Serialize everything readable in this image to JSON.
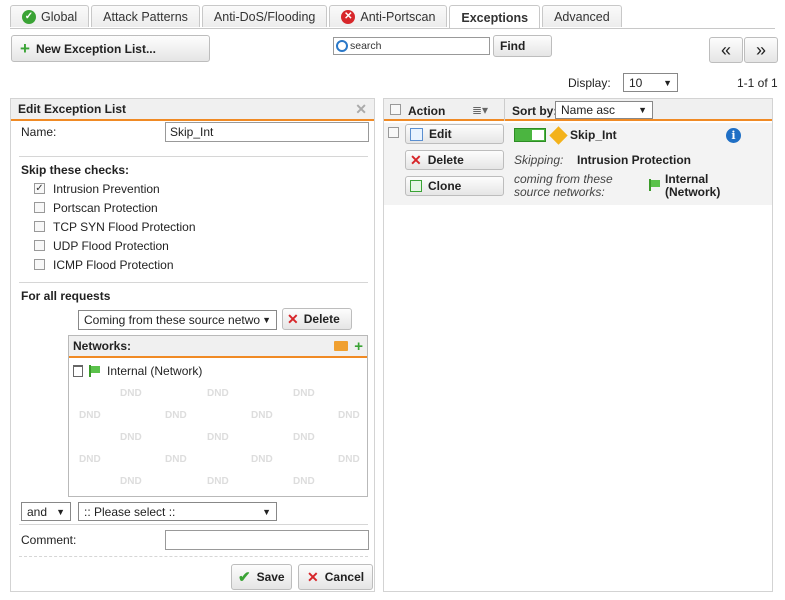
{
  "tabs": [
    {
      "label": "Global",
      "status": "ok"
    },
    {
      "label": "Attack Patterns"
    },
    {
      "label": "Anti-DoS/Flooding"
    },
    {
      "label": "Anti-Portscan",
      "status": "error"
    },
    {
      "label": "Exceptions",
      "active": true
    },
    {
      "label": "Advanced"
    }
  ],
  "toolbar": {
    "new_label": "New Exception List...",
    "search_placeholder": "search",
    "find_label": "Find",
    "prev_label": "«",
    "next_label": "»"
  },
  "display": {
    "label": "Display:",
    "value": "10",
    "pager": "1-1 of 1"
  },
  "edit_panel": {
    "title": "Edit Exception List",
    "name_label": "Name:",
    "name_value": "Skip_Int",
    "skip_heading": "Skip these checks:",
    "checks": [
      {
        "label": "Intrusion Prevention",
        "checked": true
      },
      {
        "label": "Portscan Protection",
        "checked": false
      },
      {
        "label": "TCP SYN Flood Protection",
        "checked": false
      },
      {
        "label": "UDP Flood Protection",
        "checked": false
      },
      {
        "label": "ICMP Flood Protection",
        "checked": false
      }
    ],
    "all_requests_heading": "For all requests",
    "condition_select": "Coming from these source netwo",
    "delete_label": "Delete",
    "networks_label": "Networks:",
    "network_item": "Internal (Network)",
    "dnd_text": "DND",
    "and_select": "and",
    "please_select": ":: Please select ::",
    "comment_label": "Comment:",
    "comment_value": "",
    "save_label": "Save",
    "cancel_label": "Cancel"
  },
  "list_panel": {
    "action_label": "Action",
    "sort_label": "Sort by:",
    "sort_value": "Name asc",
    "edit_label": "Edit",
    "delete_label": "Delete",
    "clone_label": "Clone",
    "item_name": "Skip_Int",
    "skipping_label": "Skipping:",
    "skipping_value": "Intrusion Protection",
    "source_label": "coming from these source networks:",
    "source_value": "Internal (Network)"
  },
  "colors": {
    "accent": "#f08a24",
    "ok": "#3aa335",
    "error": "#d7262a",
    "info": "#1f6fc5"
  }
}
